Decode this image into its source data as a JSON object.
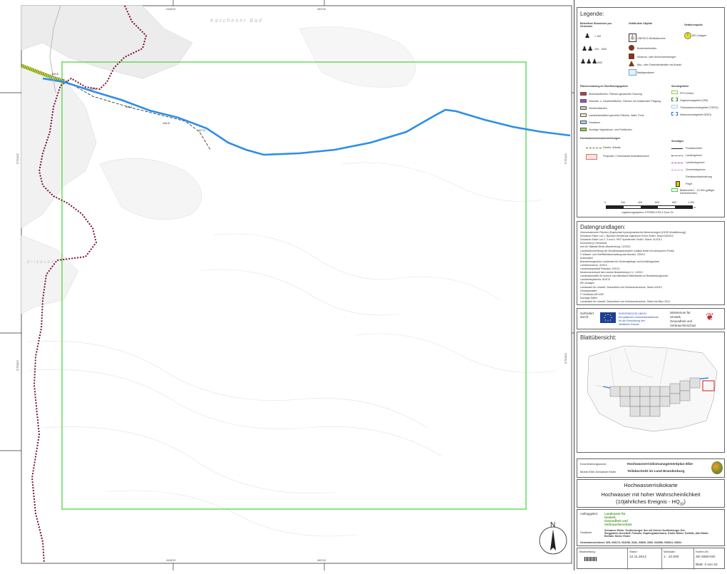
{
  "map": {
    "frame_coords": {
      "top_left": "418210",
      "top_right": "440'18",
      "bottom_left": "418210",
      "bottom_right": "440'18",
      "left_upper": "5'76'422",
      "left_lower": "5'75'822",
      "right_upper": "5'76'422",
      "right_lower": "5'75'822"
    },
    "place_labels": [
      "Kaschener Bad",
      "Erikesee"
    ],
    "river_labels": [
      "115,8",
      "115,5",
      "116,1",
      "116,8",
      "117,0"
    ]
  },
  "legend": {
    "title": "Legende:",
    "col_people": "Betroffene Einwohner pro Gemeinde",
    "col_objects": "Gefährdete Objekte",
    "col_sources": "Gefahrenquelle",
    "people": [
      "< 100",
      "100 - 1000",
      "> 1000"
    ],
    "objects": [
      "UNESCO-Weltkulturerbe",
      "Bodendenkmäler",
      "Museum- oder Archivsammlungen",
      "Bau- oder Gartendenkmäler mit Anzahl",
      "Badegewässer"
    ],
    "sources": [
      "IED-Anlagen"
    ],
    "landuse_title": "Flächennutzung im Überflutungsgebiet",
    "landuse": [
      {
        "label": "Wohnbauflächen, Flächen gemischter Nutzung",
        "color": "#d62f4a"
      },
      {
        "label": "Industrie- u. Gewerbeflächen, Flächen mit funktionaler Prägung",
        "color": "#a64bc7"
      },
      {
        "label": "Verkehrsflächen",
        "color": "#c8c8c8"
      },
      {
        "label": "Landwirtschaftlich genutzte Flächen, Wald, Forst",
        "color": "#f3f0b8"
      },
      {
        "label": "Gewässer",
        "color": "#9fd3ee"
      },
      {
        "label": "Sonstige Vegetations- und Freiflächen",
        "color": "#9bd04a"
      }
    ],
    "protect_title": "Schutzgebiete",
    "protect": [
      "FFH-Gebiet",
      "Vogelschutzgebiet (SPA)",
      "Trinkwasserschutzgebiet (TWSG)",
      "Wasserschutzgebiet (WSG)"
    ],
    "flood_title": "Hochwasserschutzeinrichtungen",
    "flood": [
      "Deiche, Wände",
      "Flutpolder / Hochwasserrückhaltebecken"
    ],
    "misc_title": "Sonstiges",
    "misc": [
      "Flusskilometer",
      "Landesgrenze",
      "Landkreisgrenze",
      "Gemeindegrenze",
      "Gewässerstationierung",
      "Pegel",
      "Blattschnitt 1 : 10 000 (gültiger Kartenbereich)"
    ],
    "scale_ticks": [
      "0",
      "200",
      "400",
      "600",
      "800",
      "1.000"
    ],
    "scale_unit": "m",
    "crs": "Lagebezugssystem: ETRS89 UTM 4 Zone 33"
  },
  "sources": {
    "title": "Datengrundlagen:",
    "lines": [
      "Überschwemmte Flächen (Ergebnisse hydrodynamischer Berechnungen (1D/2D-Modellierung))",
      "Schwarze Elster Los 1: Björnsen Beratende Ingenieure Erfurt GmbH, Stand 05/2013",
      "Schwarze Elster Los 2, 3 und 4: HHT Hydrotender GmbH, Stand: 01/2013",
      "Einwohner je Gemeinde",
      "Amt für Statistik Berlin-Brandenburg, 12/2013",
      "Landesbeschreibung der Bundeswasserstraßen (radikal findet mit schwarzem Punkt)",
      "© Wasser- und Schifffahrtsverwaltung des Bundes, 3/2013",
      "Kulturdaten",
      "Brandenburgisches Landesamt für Denkmalpflege und Archäologisches",
      "Landesmuseum, 4/2013",
      "Landeshauptstadt Potsdam, 2/2013",
      "Museumsverband des Landes Brandenburg e.V., 1/2013",
      "Landesfachstelle für Archive und öffentliche Bibliotheken im Brandenburgischen",
      "Landeshauptarchiv, 8/2013",
      "IED-Anlagen",
      "Landesamt für Umwelt, Gesundheit und Verbraucherschutz, Stand 4/2013",
      "Geobasisdaten",
      "© GeoBasis-DE/LGB",
      "Sonstige Daten",
      "Landesamt für Umwelt, Gesundheit und Verbraucherschutz, Stand bis März 2013"
    ]
  },
  "funding": {
    "label": "Gefördert durch:",
    "eu_text": [
      "EUROPÄISCHE UNION",
      "Europäischer Landwirtschaftsfonds",
      "für die Entwicklung des",
      "ländlichen Raums"
    ],
    "ministry": [
      "Ministerium für",
      "Umwelt,",
      "Gesundheit und",
      "Verbraucherschutz"
    ]
  },
  "overview": {
    "title": "Blattübersicht:"
  },
  "project": {
    "crs_label": "Koordinierungsraum:",
    "crs_value": "Mulde-Elbe-Schwarze Elster",
    "plan_title": "Hochwasserrisikomanagementplan Elbe",
    "plan_sub": "Teilabschnitt im Land Brandenburg"
  },
  "title": {
    "map_type": "Hochwasserrisikokarte",
    "line1": "Hochwasser mit hoher Wahrscheinlichkeit",
    "line2": "(10jährliches Ereignis - HQ",
    "line2_sub": "10",
    "line2_end": ")"
  },
  "client": {
    "label": "Auftraggeber:",
    "name": [
      "Landesamt für",
      "Umwelt,",
      "Gesundheit und",
      "Verbraucherschutz"
    ]
  },
  "waters": {
    "label": "Gewässer:",
    "text": [
      "Schwarze Elster, Senftenberger See mit kleiner Senftenberger See,",
      "Steggraben Annetteff, Pulsnitz, Hopfengrabenbach, Große Röder, Geißlitz, Alte Röder,",
      "Breitaer Kleine Elster"
    ]
  },
  "communes": "Gemeindeschlüssel: 305, 034172, 034158, 3342, 03830, 3366, 034086, 035514, 03664",
  "north": "N",
  "footer": {
    "editor_label": "Bearbeitung:",
    "date_label": "Stand:",
    "date": "12.11.2013",
    "scale_label": "Maßstab:",
    "scale": "1 : 10.000",
    "map_no_label": "Karten-Nr.:",
    "map_no": "SE-4550-NO",
    "sheet": "Blatt: 3 von 22"
  }
}
